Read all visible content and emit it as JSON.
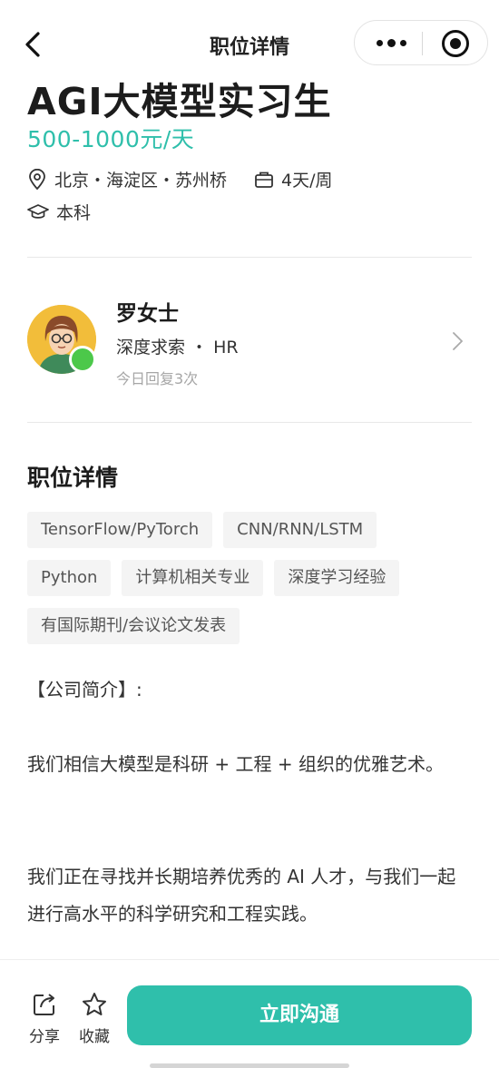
{
  "nav": {
    "title": "职位详情"
  },
  "job": {
    "title": "AGI大模型实习生",
    "salary": "500-1000元/天",
    "location": "北京・海淀区・苏州桥",
    "schedule": "4天/周",
    "education": "本科"
  },
  "hr": {
    "name": "罗女士",
    "company_role": "深度求索 ・ HR",
    "reply_stat": "今日回复3次"
  },
  "details": {
    "title": "职位详情",
    "tags": [
      "TensorFlow/PyTorch",
      "CNN/RNN/LSTM",
      "Python",
      "计算机相关专业",
      "深度学习经验",
      "有国际期刊/会议论文发表"
    ],
    "intro_heading": "【公司简介】:",
    "paragraph1": "我们相信大模型是科研 + 工程 + 组织的优雅艺术。",
    "paragraph2": "我们正在寻找并长期培养优秀的 AI 人才，与我们一起进行高水平的科学研究和工程实践。"
  },
  "bottom": {
    "share_label": "分享",
    "favorite_label": "收藏",
    "apply_label": "立即沟通"
  },
  "colors": {
    "accent": "#2fbfab",
    "online": "#4cc84a",
    "tag_bg": "#f4f4f4"
  }
}
